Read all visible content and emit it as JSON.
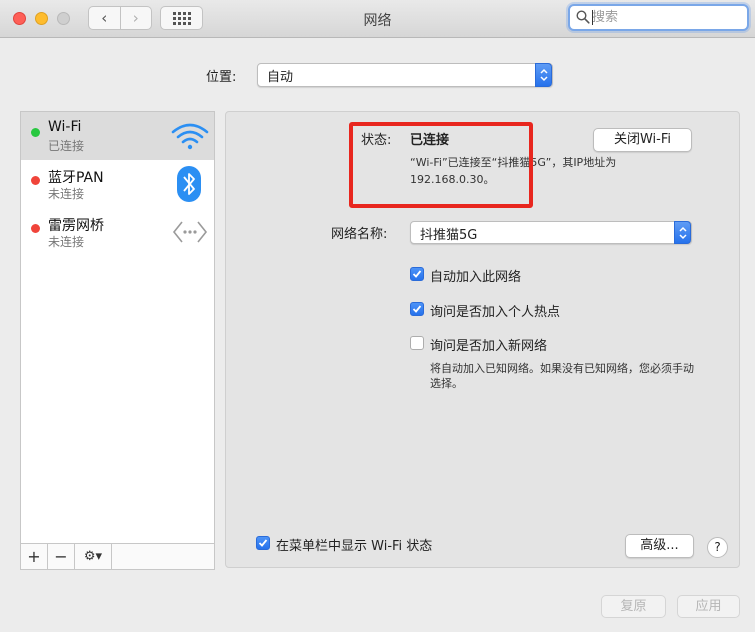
{
  "window": {
    "title": "网络"
  },
  "toolbar": {
    "back_label": "‹",
    "forward_label": "›"
  },
  "search": {
    "placeholder": "搜索",
    "value": ""
  },
  "location": {
    "label": "位置:",
    "value": "自动"
  },
  "services": [
    {
      "name": "Wi-Fi",
      "status": "已连接",
      "status_color": "#28c840",
      "icon": "wifi-icon",
      "selected": true
    },
    {
      "name": "蓝牙PAN",
      "status": "未连接",
      "status_color": "#f0443a",
      "icon": "bluetooth-icon",
      "selected": false
    },
    {
      "name": "雷雳网桥",
      "status": "未连接",
      "status_color": "#f0443a",
      "icon": "thunderbolt-bridge-icon",
      "selected": false
    }
  ],
  "sidebar_buttons": {
    "add": "+",
    "remove": "−",
    "action": "⚙▾"
  },
  "detail": {
    "status_label": "状态:",
    "status_value": "已连接",
    "turn_off_button": "关闭Wi-Fi",
    "status_description": "“Wi-Fi”已连接至“抖推猫5G”，其IP地址为 192.168.0.30。",
    "network_name_label": "网络名称:",
    "network_name_value": "抖推猫5G",
    "options": [
      {
        "label": "自动加入此网络",
        "checked": true
      },
      {
        "label": "询问是否加入个人热点",
        "checked": true
      },
      {
        "label": "询问是否加入新网络",
        "checked": false
      }
    ],
    "ask_new_note": "将自动加入已知网络。如果没有已知网络，您必须手动选择。",
    "show_menubar_label": "在菜单栏中显示 Wi-Fi 状态",
    "show_menubar_checked": true,
    "advanced_button": "高级...",
    "help_button": "?"
  },
  "footer": {
    "revert_button": "复原",
    "apply_button": "应用"
  },
  "colors": {
    "accent": "#2672ec",
    "highlight_box": "#e8261e"
  }
}
